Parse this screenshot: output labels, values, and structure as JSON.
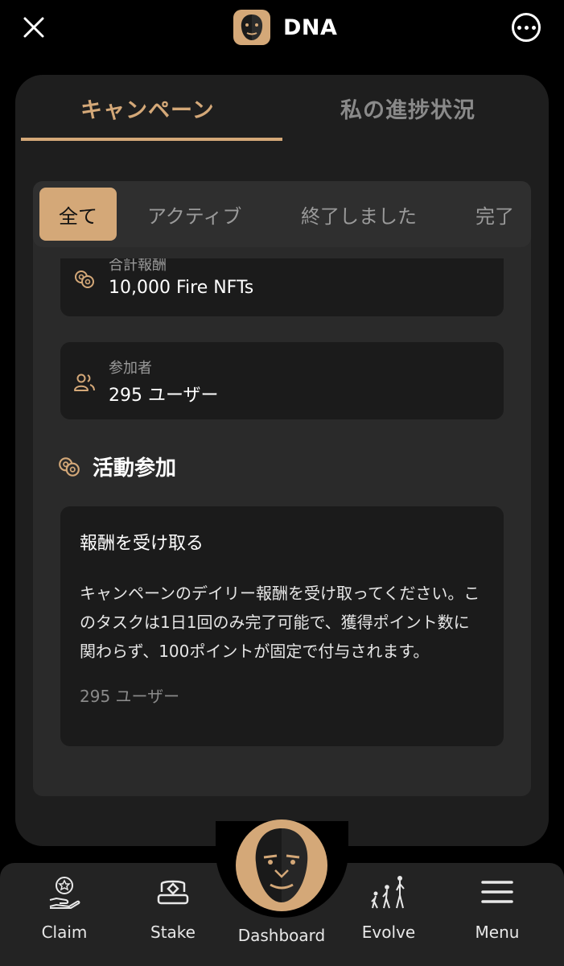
{
  "app": {
    "title": "DNA"
  },
  "main_tabs": [
    {
      "label": "キャンペーン",
      "active": true
    },
    {
      "label": "私の進捗状況",
      "active": false
    }
  ],
  "filters": [
    {
      "label": "全て",
      "active": true
    },
    {
      "label": "アクティブ",
      "active": false
    },
    {
      "label": "終了しました",
      "active": false
    },
    {
      "label": "完了",
      "active": false
    }
  ],
  "info": {
    "reward": {
      "label": "合計報酬",
      "value": "10,000 Fire NFTs",
      "icon": "coins-icon"
    },
    "participants": {
      "label": "参加者",
      "value": "295 ユーザー",
      "icon": "users-icon"
    }
  },
  "section": {
    "title": "活動参加",
    "icon": "coins-icon"
  },
  "task": {
    "title": "報酬を受け取る",
    "description": "キャンペーンのデイリー報酬を受け取ってください。このタスクは1日1回のみ完了可能で、獲得ポイント数に関わらず、100ポイントが固定で付与されます。",
    "users": "295 ユーザー"
  },
  "bottom_nav": {
    "claim": "Claim",
    "stake": "Stake",
    "dashboard": "Dashboard",
    "evolve": "Evolve",
    "menu": "Menu"
  },
  "colors": {
    "accent": "#d4a878",
    "panel": "#1e1e1e",
    "card": "#1b1b1b",
    "background": "#000000"
  }
}
